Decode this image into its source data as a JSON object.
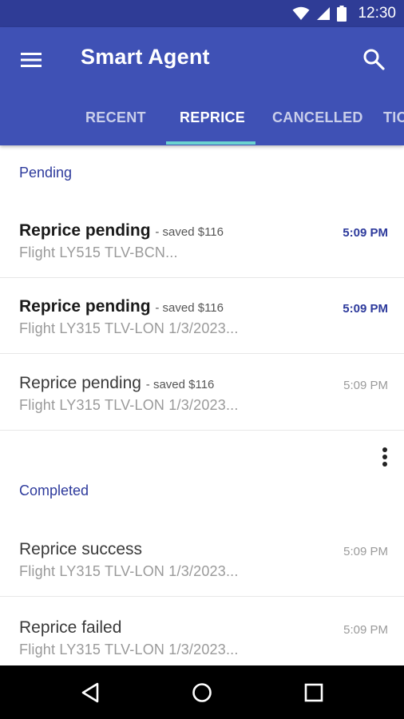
{
  "status": {
    "time": "12:30"
  },
  "app": {
    "title": "Smart Agent",
    "icons": {
      "menu": "menu-icon",
      "search": "search-icon"
    }
  },
  "tabs": [
    {
      "label": "RECENT"
    },
    {
      "label": "REPRICE",
      "active": true
    },
    {
      "label": "CANCELLED"
    },
    {
      "label": "TIC"
    }
  ],
  "sections": {
    "pending": {
      "header": "Pending",
      "items": [
        {
          "title": "Reprice pending",
          "note": "- saved $116",
          "subtitle": "Flight LY515 TLV-BCN...",
          "time": "5:09 PM",
          "unread": true
        },
        {
          "title": "Reprice pending",
          "note": "- saved $116",
          "subtitle": "Flight LY315 TLV-LON 1/3/2023...",
          "time": "5:09 PM",
          "unread": true
        },
        {
          "title": "Reprice pending",
          "note": "- saved $116",
          "subtitle": "Flight LY315 TLV-LON 1/3/2023...",
          "time": "5:09 PM",
          "unread": false
        }
      ]
    },
    "completed": {
      "header": "Completed",
      "items": [
        {
          "title": "Reprice success",
          "subtitle": "Flight LY315 TLV-LON 1/3/2023...",
          "time": "5:09 PM"
        },
        {
          "title": "Reprice failed",
          "subtitle": "Flight LY315 TLV-LON 1/3/2023...",
          "time": "5:09 PM"
        }
      ]
    }
  },
  "colors": {
    "primary": "#3f51b5",
    "primary_dark": "#2f3c96",
    "accent": "#6ad3d0",
    "section_text": "#2d3a9c"
  }
}
